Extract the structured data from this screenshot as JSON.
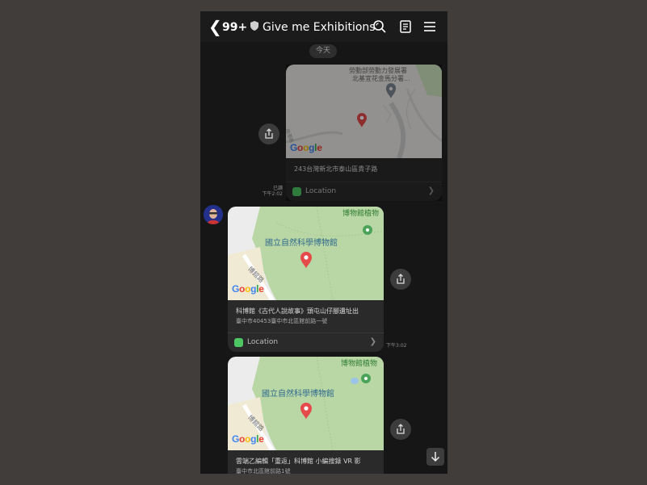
{
  "header": {
    "back_icon": "chevron-left-icon",
    "unread_count": "99+",
    "title": "Give me Exhibitions",
    "icons": [
      "search-icon",
      "notes-icon",
      "menu-icon"
    ]
  },
  "date_chip": "今天",
  "messages": [
    {
      "sender": "self",
      "map_label_line1": "勞動部勞動力發展署",
      "map_label_line2": "北基宜花金馬分署...",
      "map_street": "南港路",
      "address": "243台灣新北市泰山區貴子路",
      "location_label": "Location",
      "status_read": "已讀",
      "time": "下午2:02"
    },
    {
      "sender": "other",
      "map_label_main": "國立自然科學博物館",
      "map_label_top": "博物館植物",
      "map_street": "博館路",
      "title": "科博館《古代人說故事》頭屯山仔腳遺址出",
      "address": "臺中市40453臺中市北區館前路一號",
      "location_label": "Location",
      "time": "下午3:02"
    },
    {
      "sender": "other",
      "map_label_main": "國立自然科學博物館",
      "map_label_top": "博物館植物",
      "map_street": "博館路",
      "title": "雲端乙編輯「重返」科博館 小編搜錄 VR 影",
      "address": "臺中市北區館前路1號"
    }
  ],
  "map_brand": "Google",
  "colors": {
    "accent_green": "#4cc764",
    "pin_red": "#e54a4a",
    "park_green": "#b9d6a5"
  }
}
